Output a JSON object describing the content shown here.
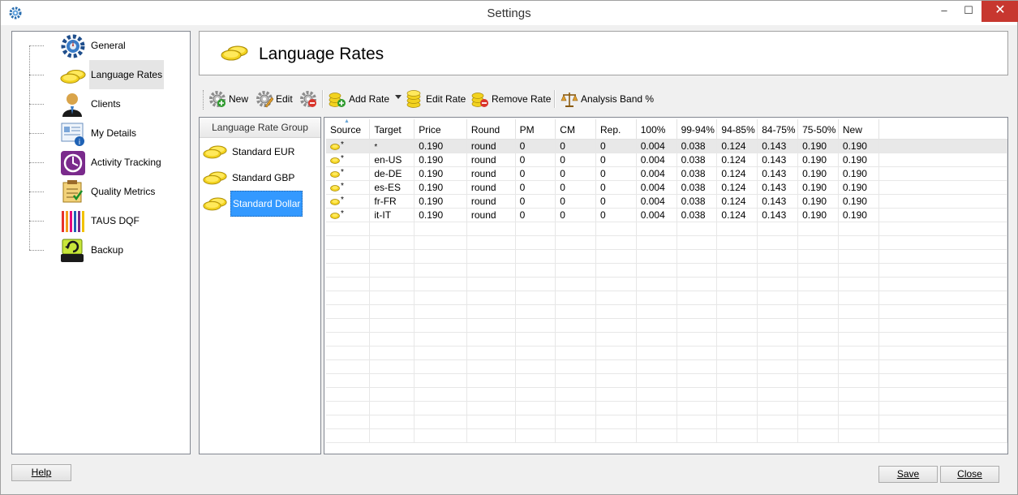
{
  "window": {
    "title": "Settings",
    "minimize": "‒",
    "maximize": "☐",
    "close": "✕"
  },
  "tree": {
    "items": [
      {
        "label": "General",
        "icon": "gear-icon"
      },
      {
        "label": "Language Rates",
        "icon": "coins-icon"
      },
      {
        "label": "Clients",
        "icon": "client-icon"
      },
      {
        "label": "My Details",
        "icon": "details-icon"
      },
      {
        "label": "Activity Tracking",
        "icon": "activity-icon"
      },
      {
        "label": "Quality Metrics",
        "icon": "quality-icon"
      },
      {
        "label": "TAUS DQF",
        "icon": "taus-icon"
      },
      {
        "label": "Backup",
        "icon": "backup-icon"
      }
    ],
    "selected": "Language Rates"
  },
  "header": {
    "title": "Language Rates"
  },
  "toolbar": {
    "new_label": "New",
    "edit_label": "Edit",
    "add_rate_label": "Add Rate",
    "edit_rate_label": "Edit Rate",
    "remove_rate_label": "Remove Rate",
    "analysis_band_label": "Analysis Band %"
  },
  "groups": {
    "header": "Language Rate Group",
    "items": [
      "Standard EUR",
      "Standard GBP",
      "Standard Dollar"
    ],
    "selected": "Standard Dollar"
  },
  "grid": {
    "columns": [
      "Source",
      "Target",
      "Price",
      "Round",
      "PM",
      "CM",
      "Rep.",
      "100%",
      "99-94%",
      "94-85%",
      "84-75%",
      "75-50%",
      "New"
    ],
    "rows": [
      [
        "*",
        "*",
        "0.190",
        "round",
        "0",
        "0",
        "0",
        "0.004",
        "0.038",
        "0.124",
        "0.143",
        "0.190",
        "0.190"
      ],
      [
        "*",
        "en-US",
        "0.190",
        "round",
        "0",
        "0",
        "0",
        "0.004",
        "0.038",
        "0.124",
        "0.143",
        "0.190",
        "0.190"
      ],
      [
        "*",
        "de-DE",
        "0.190",
        "round",
        "0",
        "0",
        "0",
        "0.004",
        "0.038",
        "0.124",
        "0.143",
        "0.190",
        "0.190"
      ],
      [
        "*",
        "es-ES",
        "0.190",
        "round",
        "0",
        "0",
        "0",
        "0.004",
        "0.038",
        "0.124",
        "0.143",
        "0.190",
        "0.190"
      ],
      [
        "*",
        "fr-FR",
        "0.190",
        "round",
        "0",
        "0",
        "0",
        "0.004",
        "0.038",
        "0.124",
        "0.143",
        "0.190",
        "0.190"
      ],
      [
        "*",
        "it-IT",
        "0.190",
        "round",
        "0",
        "0",
        "0",
        "0.004",
        "0.038",
        "0.124",
        "0.143",
        "0.190",
        "0.190"
      ]
    ]
  },
  "buttons": {
    "help": "Help",
    "save": "Save",
    "close": "Close"
  },
  "colors": {
    "selection": "#3399ff",
    "close_button": "#c7372f",
    "coin": "#f2d21f"
  }
}
